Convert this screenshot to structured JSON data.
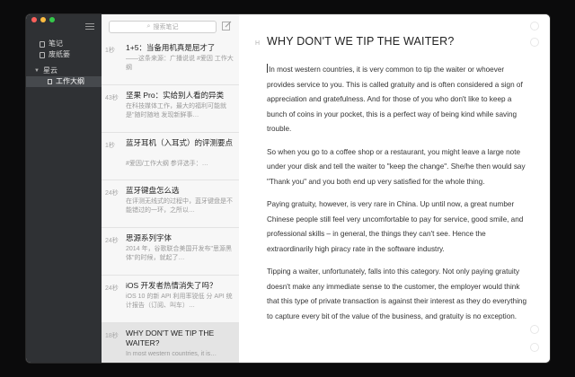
{
  "sidebar": {
    "items": [
      {
        "label": "笔记"
      },
      {
        "label": "废纸篓"
      }
    ],
    "group": {
      "label": "星云"
    },
    "subitem": {
      "label": "工作大纲"
    }
  },
  "list": {
    "search_placeholder": "搜索笔记",
    "notes": [
      {
        "age": "1秒",
        "title": "1+5：当备用机真是屈才了",
        "snippet": "——这条来源：广播说说 #爱因 工作大纲"
      },
      {
        "age": "43秒",
        "title": "坚果 Pro：实给别人看的异类",
        "snippet": "在科技媒体工作，最大的福利可能就是\"随时随地 发现新鲜事…"
      },
      {
        "age": "1秒",
        "title": "蓝牙耳机（入耳式）的评测要点",
        "snippet": "#爱因/工作大纲 参评选手：…"
      },
      {
        "age": "24秒",
        "title": "蓝牙键盘怎么选",
        "snippet": "在评测无线式的过程中，蓝牙键盘是不能错过的一环，之所以…"
      },
      {
        "age": "24秒",
        "title": "思源系列字体",
        "snippet": "2014 年，谷歌联合美国开发布\"思源黑体\"的时候，就起了…"
      },
      {
        "age": "24秒",
        "title": "iOS 开发者热情消失了吗？",
        "snippet": "iOS 10 的新 API 利用率锐低 分 API 统计报告（订阅、叫车）…"
      },
      {
        "age": "18秒",
        "title": "WHY DON'T WE TIP THE WAITER?",
        "snippet": "In most western countries, it is…"
      }
    ]
  },
  "editor": {
    "heading_marker": "H",
    "title": "WHY DON'T WE TIP THE WAITER?",
    "paragraphs": [
      "In most western countries, it is very common to tip the waiter or whoever provides service to you. This is called gratuity and is often considered a sign of appreciation and gratefulness. And for those of you who don't like to keep a bunch of coins in your pocket, this is a perfect way of being kind while saving trouble.",
      "So when you go to a coffee shop or a restaurant, you might leave a large note under your disk and tell the waiter to \"keep the change\". She/he then would say \"Thank you\" and you both end up very satisfied for the whole thing.",
      "Paying gratuity, however, is very rare in China. Up until now, a great number Chinese people still feel very uncomfortable to pay for service, good smile, and professional skills – in general, the things they can't see. Hence the extraordinarily high piracy rate in the software industry.",
      "Tipping a waiter, unfortunately, falls into this category. Not only paying gratuity doesn't make any immediate sense to the customer, the employer would think that this type of private transaction is against their interest as they do everything to capture every bit of the value of the business, and gratuity is no exception."
    ]
  },
  "colors": {
    "sidebar_bg": "#2f3134",
    "list_bg": "#f7f7f7",
    "active_item_bg": "#e4e4e4"
  }
}
